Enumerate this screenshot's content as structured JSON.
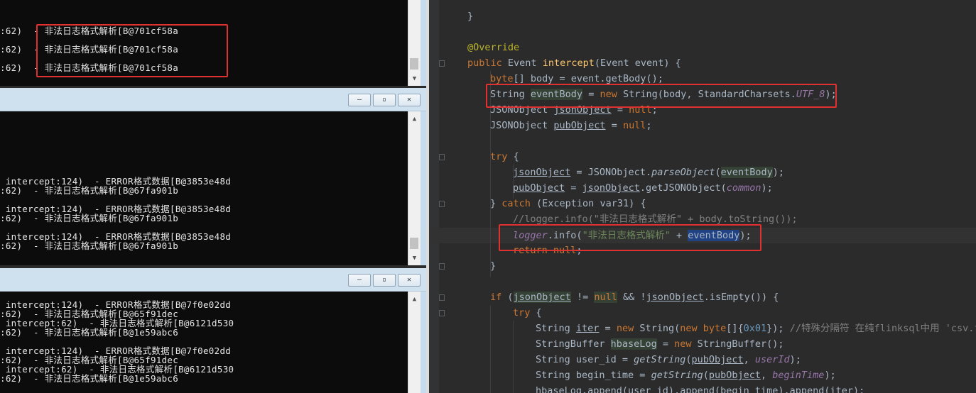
{
  "terminals": [
    {
      "id": "top",
      "lines": [
        ":62)  - 非法日志格式解析[B@701cf58a",
        ":62)  - 非法日志格式解析[B@701cf58a",
        ":62)  - 非法日志格式解析[B@701cf58a"
      ]
    },
    {
      "id": "middle",
      "win_buttons": [
        "—",
        "▫",
        "✕"
      ],
      "lines": [
        " intercept:124)  - ERROR格式数据[B@3853e48d",
        ":62)  - 非法日志格式解析[B@67fa901b",
        "",
        " intercept:124)  - ERROR格式数据[B@3853e48d",
        ":62)  - 非法日志格式解析[B@67fa901b",
        "",
        " intercept:124)  - ERROR格式数据[B@3853e48d",
        ":62)  - 非法日志格式解析[B@67fa901b"
      ]
    },
    {
      "id": "bottom",
      "win_buttons": [
        "—",
        "▫",
        "✕"
      ],
      "lines": [
        " intercept:124)  - ERROR格式数据[B@7f0e02dd",
        ":62)  - 非法日志格式解析[B@65f91dec",
        " intercept:62)  - 非法日志格式解析[B@6121d530",
        ":62)  - 非法日志格式解析[B@1e59abc6",
        "",
        " intercept:124)  - ERROR格式数据[B@7f0e02dd",
        ":62)  - 非法日志格式解析[B@65f91dec",
        " intercept:62)  - 非法日志格式解析[B@6121d530",
        ":62)  - 非法日志格式解析[B@1e59abc6"
      ]
    }
  ],
  "code": {
    "line1": "}",
    "annotation": "@Override",
    "sig_kw": "public",
    "sig_type": "Event",
    "sig_name": "intercept",
    "sig_params": "(Event event) {",
    "l_body_kw": "byte",
    "l_body_rest": "[] body = event.getBody();",
    "l_str_type": "String ",
    "l_str_var": "eventBody",
    "l_str_eq": " = ",
    "l_str_new": "new",
    "l_str_call": " String(body, StandardCharsets.",
    "l_str_const": "UTF_8",
    "l_str_end": ");",
    "l_json1_type": "JSONObject ",
    "l_json1_var": "jsonObject",
    "l_json1_eq": " = ",
    "l_json1_null": "null",
    "l_json1_end": ";",
    "l_json2_type": "JSONObject ",
    "l_json2_var": "pubObject",
    "l_json2_eq": " = ",
    "l_json2_null": "null",
    "l_json2_end": ";",
    "l_try": "try",
    "l_try_brace": " {",
    "l_parse_var": "jsonObject",
    "l_parse_mid": " = JSONObject.",
    "l_parse_fn": "parseObject",
    "l_parse_open": "(",
    "l_parse_arg": "eventBody",
    "l_parse_end": ");",
    "l_pub_var": "pubObject",
    "l_pub_eq": " = ",
    "l_pub_obj": "jsonObject",
    "l_pub_mid": ".getJSONObject(",
    "l_pub_arg": "common",
    "l_pub_end": ");",
    "l_catch_close": "} ",
    "l_catch_kw": "catch",
    "l_catch_rest": " (Exception var31) {",
    "l_comment": "//logger.info(\"非法日志格式解析\" + body.toString());",
    "l_log_obj": "logger",
    "l_log_mid": ".info(",
    "l_log_str": "\"非法日志格式解析\"",
    "l_log_plus": " + ",
    "l_log_var": "eventBody",
    "l_log_end": ");",
    "l_ret_kw": "return",
    "l_ret_null": " null",
    "l_ret_end": ";",
    "l_close": "}",
    "l_if_kw": "if",
    "l_if_open": " (",
    "l_if_var": "jsonObject",
    "l_if_ne": " != ",
    "l_if_null": "null",
    "l_if_and": " && !",
    "l_if_var2": "jsonObject",
    "l_if_end": ".isEmpty()) {",
    "l_try2": "try",
    "l_try2_brace": " {",
    "l_iter_type": "String ",
    "l_iter_var": "iter",
    "l_iter_eq": " = ",
    "l_iter_new": "new",
    "l_iter_mid": " String(",
    "l_iter_new2": "new",
    "l_iter_byte": " byte",
    "l_iter_arr": "[]{",
    "l_iter_num": "0x01",
    "l_iter_end": "}); ",
    "l_iter_cmt": "//特殊分隔符 在纯flinksql中用 'csv.fi",
    "l_sb_type": "StringBuffer ",
    "l_sb_var": "hbaseLog",
    "l_sb_eq": " = ",
    "l_sb_new": "new",
    "l_sb_end": " StringBuffer();",
    "l_uid_type": "String user_id = ",
    "l_uid_fn": "getString",
    "l_uid_open": "(",
    "l_uid_obj": "pubObject",
    "l_uid_comma": ", ",
    "l_uid_fld": "userId",
    "l_uid_end": ");",
    "l_bt_type": "String begin_time = ",
    "l_bt_fn": "getString",
    "l_bt_open": "(",
    "l_bt_obj": "pubObject",
    "l_bt_comma": ", ",
    "l_bt_fld": "beginTime",
    "l_bt_end": ");",
    "l_last": "hbaseLog.append(user_id).append(begin_time).append(iter);"
  },
  "colors": {
    "highlight_box": "#e03030",
    "keyword": "#cc7832",
    "string": "#6a8759",
    "field": "#9876aa",
    "function": "#ffc66d",
    "annotation": "#bbb529",
    "terminal_bg": "#0c0c0c",
    "editor_bg": "#2b2b2b"
  }
}
